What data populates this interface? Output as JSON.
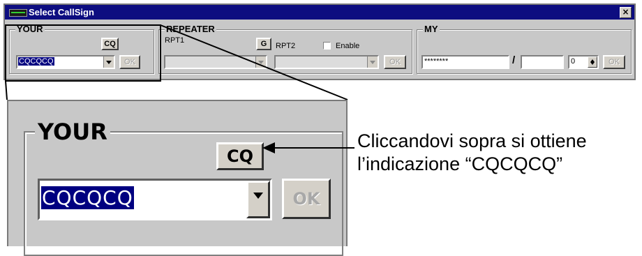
{
  "window": {
    "title": "Select CallSign",
    "close_glyph": "×"
  },
  "your": {
    "label": "YOUR",
    "cq_label": "CQ",
    "value": "CQCQCQ",
    "ok_label": "OK"
  },
  "repeater": {
    "label": "REPEATER",
    "g_label": "G",
    "rpt1_label": "RPT1",
    "rpt2_label": "RPT2",
    "enable_label": "Enable",
    "enable_checked": false,
    "ok_label": "OK",
    "ok2_label": "OK"
  },
  "my": {
    "label": "MY",
    "callsign_value": "********",
    "separator": "/",
    "suffix_value": "",
    "memory_value": "0",
    "ok_label": "OK"
  },
  "zoom": {
    "label": "YOUR",
    "cq_label": "CQ",
    "value": "CQCQCQ",
    "ok_label": "OK"
  },
  "annotation": {
    "line1": "Cliccandovi sopra si ottiene",
    "line2": "l’indicazione “CQCQCQ”"
  }
}
